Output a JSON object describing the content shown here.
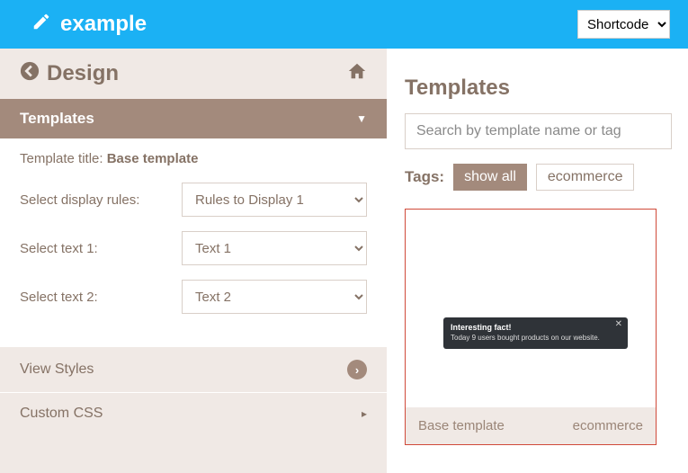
{
  "topbar": {
    "title": "example",
    "shortcode_selected": "Shortcode"
  },
  "sidebar": {
    "back_label": "Design",
    "sections": {
      "templates": {
        "label": "Templates"
      },
      "view_styles": {
        "label": "View Styles"
      },
      "custom_css": {
        "label": "Custom CSS"
      }
    },
    "template_title_label": "Template title:",
    "template_title_value": "Base template",
    "rows": [
      {
        "label": "Select display rules:",
        "value": "Rules to Display 1"
      },
      {
        "label": "Select text 1:",
        "value": "Text 1"
      },
      {
        "label": "Select text 2:",
        "value": "Text 2"
      }
    ]
  },
  "right": {
    "title": "Templates",
    "search_placeholder": "Search by template name or tag",
    "tags_label": "Tags:",
    "tags": {
      "show_all": "show all",
      "ecommerce": "ecommerce"
    },
    "card": {
      "notif_title": "Interesting fact!",
      "notif_body": "Today 9 users bought products on our website.",
      "footer_name": "Base template",
      "footer_tag": "ecommerce"
    }
  }
}
